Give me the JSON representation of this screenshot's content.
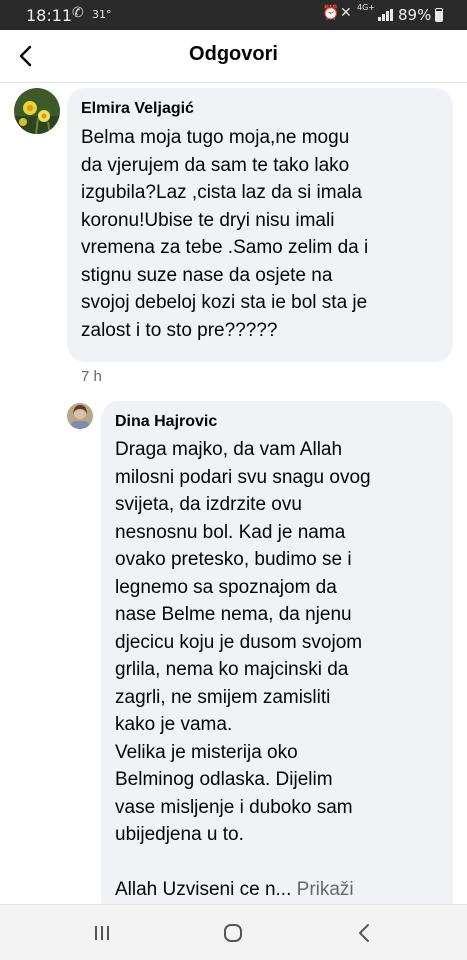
{
  "status_bar": {
    "time": "18:11",
    "temperature": "31°",
    "network": "4G+",
    "battery": "89%"
  },
  "header": {
    "title": "Odgovori"
  },
  "comments": [
    {
      "author": "Elmira Veljagić",
      "text": "Belma moja tugo moja,ne mogu\nda vjerujem da sam te tako lako\nizgubila?Laz ,cista laz da si imala\nkoronu!Ubise te dryi nisu imali\nvremena za tebe .Samo zelim da i\nstignu suze nase da osjete na\nsvojoj debeloj kozi sta ie bol sta je\nzalost i to sto pre?????",
      "time": "7 h"
    },
    {
      "author": "Dina Hajrovic",
      "text": "Draga majko, da vam Allah\nmilosni podari svu snagu ovog\nsvijeta, da izdrzite ovu\nnesnosnu bol. Kad je nama\novako pretesko, budimo se i\nlegnemo sa spoznajom da\nnase Belme nema, da njenu\ndjecicu koju je dusom svojom\ngrlila, nema ko majcinski da\nzagrli, ne smijem zamisliti\nkako je vama.\nVelika je misterija oko\nBelminog odlaska. Dijelim\nvase misljenje i duboko sam\nubijedjena u to.",
      "last_line": "Allah Uzviseni ce n... ",
      "see_more": "Prikaži"
    }
  ],
  "colors": {
    "bubble": "#f0f2f5",
    "secondary_text": "#65676b",
    "status_bar": "#2a2a2a"
  }
}
